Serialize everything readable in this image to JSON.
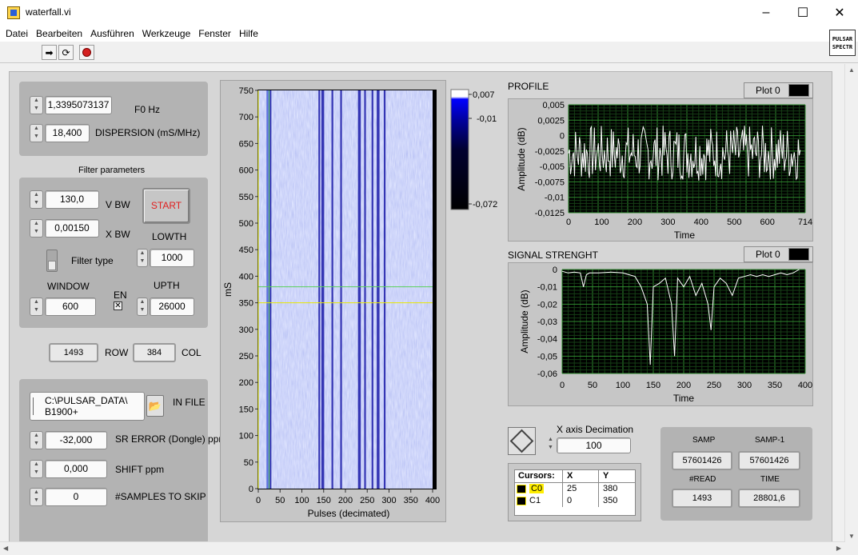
{
  "window": {
    "title": "waterfall.vi",
    "minimize": "–",
    "maximize": "☐",
    "close": "✕",
    "vi_icon_text": "PULSAR SPECTR"
  },
  "menu": [
    "Datei",
    "Bearbeiten",
    "Ausführen",
    "Werkzeuge",
    "Fenster",
    "Hilfe"
  ],
  "toolbar": {
    "run_icon": "run-arrow-icon",
    "continuous_icon": "run-continuously-icon",
    "abort_icon": "abort-icon"
  },
  "controls": {
    "f0": {
      "value": "1,3395073137",
      "label": "F0 Hz"
    },
    "dispersion": {
      "value": "18,400",
      "label": "DISPERSION (mS/MHz)"
    },
    "filter_title": "Filter parameters",
    "vbw": {
      "value": "130,0",
      "label": "V BW"
    },
    "xbw": {
      "value": "0,00150",
      "label": "X BW"
    },
    "start_label": "START",
    "lowth": {
      "value": "1000",
      "label": "LOWTH"
    },
    "filter_type_label": "Filter type",
    "window": {
      "value": "600",
      "label": "WINDOW"
    },
    "en_label": "EN",
    "upth": {
      "value": "26000",
      "label": "UPTH"
    },
    "row": {
      "value": "1493",
      "label": "ROW"
    },
    "col": {
      "value": "384",
      "label": "COL"
    },
    "in_file": {
      "value_line1": "C:\\PULSAR_DATA\\",
      "value_line2": "B1900+",
      "label": "IN FILE"
    },
    "sr_error": {
      "value": "-32,000",
      "label": "SR ERROR (Dongle) ppm"
    },
    "shift": {
      "value": "0,000",
      "label": "SHIFT ppm"
    },
    "skip": {
      "value": "0",
      "label": "#SAMPLES TO SKIP"
    }
  },
  "waterfall": {
    "ylabel": "mS",
    "xlabel": "Pulses (decimated)",
    "yticks": [
      "750",
      "700",
      "650",
      "600",
      "550",
      "500",
      "450",
      "400",
      "350",
      "300",
      "250",
      "200",
      "150",
      "100",
      "50",
      "0"
    ],
    "xticks": [
      "0",
      "50",
      "100",
      "150",
      "200",
      "250",
      "300",
      "350",
      "400"
    ],
    "colorbar": [
      "0,007",
      "-0,01",
      "-0,072"
    ]
  },
  "profile": {
    "title": "PROFILE",
    "legend": "Plot 0",
    "ylabel": "Amplitude (dB)",
    "xlabel": "Time",
    "yticks": [
      "0,005",
      "0,0025",
      "0",
      "-0,0025",
      "-0,005",
      "-0,0075",
      "-0,01",
      "-0,0125"
    ],
    "xticks": [
      "0",
      "100",
      "200",
      "300",
      "400",
      "500",
      "600",
      "714"
    ]
  },
  "signal": {
    "title": "SIGNAL STRENGHT",
    "legend": "Plot 0",
    "ylabel": "Amplitude (dB)",
    "xlabel": "Time",
    "yticks": [
      "0",
      "-0,01",
      "-0,02",
      "-0,03",
      "-0,04",
      "-0,05",
      "-0,06"
    ],
    "xticks": [
      "0",
      "50",
      "100",
      "150",
      "200",
      "250",
      "300",
      "350",
      "400"
    ]
  },
  "decimation": {
    "label": "X axis Decimation",
    "value": "100"
  },
  "cursors": {
    "header": [
      "Cursors:",
      "X",
      "Y"
    ],
    "rows": [
      {
        "name": "C0",
        "x": "25",
        "y": "380"
      },
      {
        "name": "C1",
        "x": "0",
        "y": "350"
      }
    ]
  },
  "stats": {
    "samp": {
      "label": "SAMP",
      "value": "57601426"
    },
    "samp1": {
      "label": "SAMP-1",
      "value": "57601426"
    },
    "read": {
      "label": "#READ",
      "value": "1493"
    },
    "time": {
      "label": "TIME",
      "value": "28801,6"
    }
  },
  "chart_data": [
    {
      "type": "heatmap",
      "title": "",
      "xlabel": "Pulses (decimated)",
      "ylabel": "mS",
      "xlim": [
        0,
        400
      ],
      "ylim": [
        0,
        750
      ],
      "dark_stripes_x": [
        22,
        28,
        140,
        148,
        170,
        190,
        232,
        245,
        262,
        275,
        290
      ],
      "cursor_lines": {
        "vertical_x": 25,
        "horizontal_y": [
          380,
          350
        ]
      },
      "colorbar_range": [
        -0.072,
        0.007
      ]
    },
    {
      "type": "line",
      "title": "PROFILE",
      "xlabel": "Time",
      "ylabel": "Amplitude (dB)",
      "xlim": [
        0,
        714
      ],
      "ylim": [
        -0.0125,
        0.005
      ],
      "series": [
        {
          "name": "Plot 0"
        }
      ]
    },
    {
      "type": "line",
      "title": "SIGNAL STRENGHT",
      "xlabel": "Time",
      "ylabel": "Amplitude (dB)",
      "xlim": [
        0,
        400
      ],
      "ylim": [
        -0.06,
        0
      ],
      "series": [
        {
          "name": "Plot 0",
          "x": [
            0,
            10,
            20,
            30,
            35,
            40,
            45,
            50,
            60,
            80,
            100,
            110,
            120,
            130,
            140,
            145,
            150,
            160,
            170,
            180,
            185,
            190,
            200,
            210,
            220,
            230,
            240,
            245,
            250,
            260,
            270,
            280,
            290,
            300,
            310,
            320,
            330,
            340,
            350,
            360,
            370,
            380,
            390
          ],
          "y": [
            -0.001,
            -0.002,
            -0.0015,
            -0.002,
            -0.01,
            -0.003,
            -0.002,
            -0.002,
            -0.002,
            -0.0015,
            -0.002,
            -0.003,
            -0.004,
            -0.01,
            -0.02,
            -0.055,
            -0.01,
            -0.008,
            -0.005,
            -0.02,
            -0.05,
            -0.005,
            -0.01,
            -0.004,
            -0.015,
            -0.008,
            -0.02,
            -0.035,
            -0.01,
            -0.005,
            -0.008,
            -0.015,
            -0.005,
            -0.004,
            -0.003,
            -0.004,
            -0.003,
            -0.004,
            -0.003,
            -0.002,
            -0.003,
            -0.002,
            0.0
          ]
        }
      ]
    }
  ]
}
